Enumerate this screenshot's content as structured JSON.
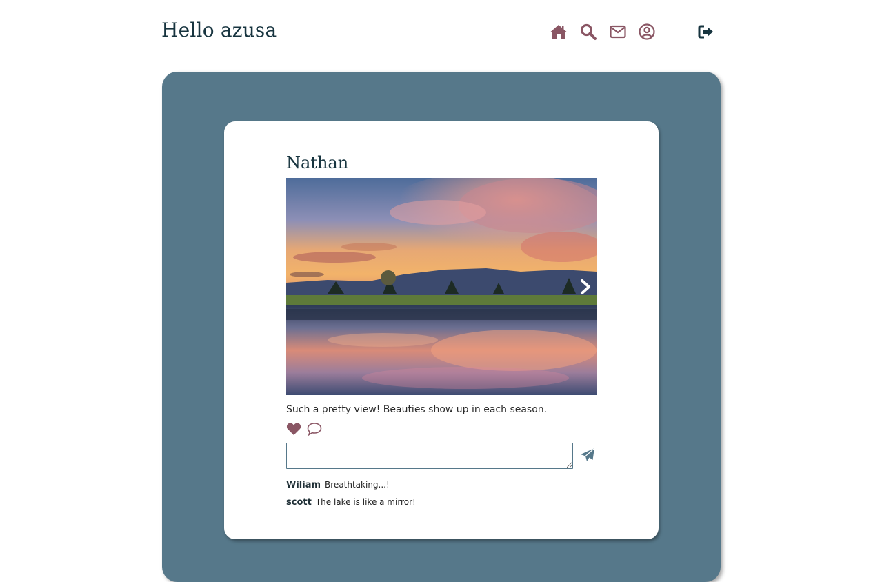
{
  "header": {
    "greeting": "Hello azusa",
    "nav": [
      {
        "icon": "home-icon",
        "color": "#8a5664"
      },
      {
        "icon": "search-icon",
        "color": "#8a5664"
      },
      {
        "icon": "envelope-icon",
        "color": "#8a5664"
      },
      {
        "icon": "user-circle-icon",
        "color": "#8a5664"
      },
      {
        "icon": "sign-out-icon",
        "color": "#17343f"
      }
    ]
  },
  "colors": {
    "panel": "#56788a",
    "accent": "#8a5664",
    "heading": "#17343f"
  },
  "post": {
    "author": "Nathan",
    "image": "lake-sunset-reflection",
    "caption": "Such a pretty view! Beauties show up in each season.",
    "liked": true,
    "comment_input_value": "",
    "comments": [
      {
        "user": "Wiliam",
        "text": "Breathtaking...!"
      },
      {
        "user": "scott",
        "text": "The lake is like a mirror!"
      }
    ]
  }
}
